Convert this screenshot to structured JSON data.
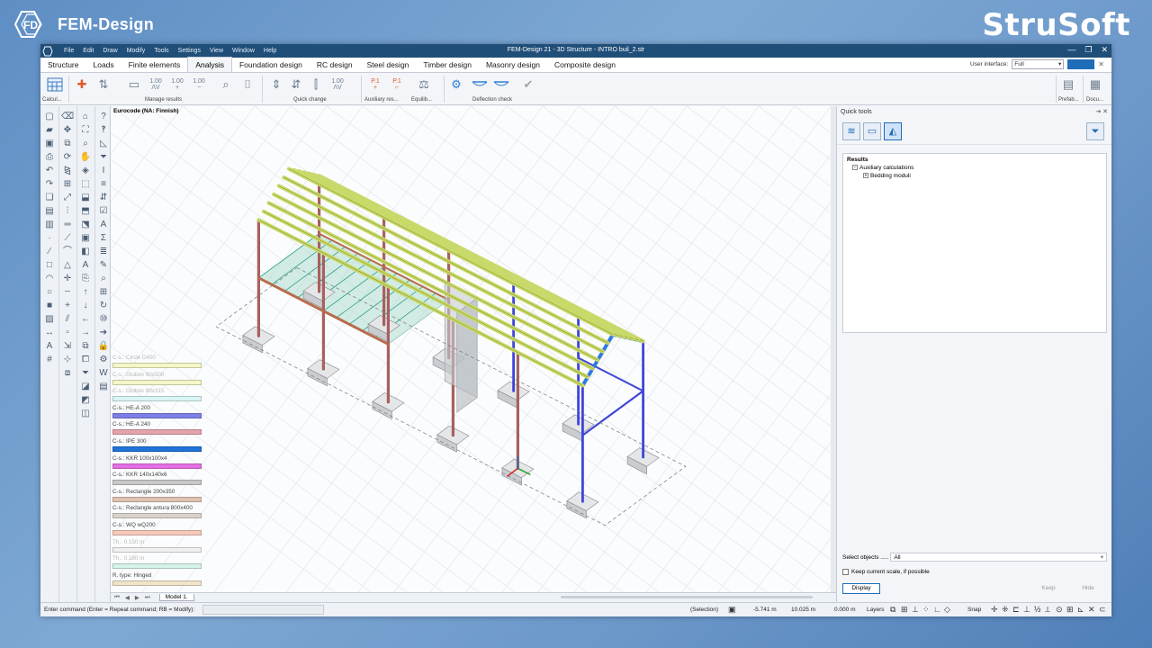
{
  "brand": {
    "left_name": "FEM-Design",
    "right_name": "StruSoft"
  },
  "window": {
    "title": "FEM-Design 21 - 3D Structure - INTRO buil_2.str",
    "menu": [
      "File",
      "Edit",
      "Draw",
      "Modify",
      "Tools",
      "Settings",
      "View",
      "Window",
      "Help"
    ],
    "controls": [
      "—",
      "❐",
      "✕"
    ]
  },
  "ribbon_tabs": [
    "Structure",
    "Loads",
    "Finite elements",
    "Analysis",
    "Foundation design",
    "RC design",
    "Steel design",
    "Timber design",
    "Masonry design",
    "Composite design"
  ],
  "active_tab": "Analysis",
  "user_interface": {
    "label": "User interface:",
    "value": "Full"
  },
  "ribbon_groups": {
    "calc": "Calcul...",
    "manage_results": "Manage results",
    "quick_change": "Quick change",
    "auxiliary": "Auxiliary res...",
    "equilib": "Equilib...",
    "deflection": "Deflection check",
    "prefab": "Prefab...",
    "docu": "Docu..."
  },
  "ribbon_icon_labels": {
    "p1_a": "P.1",
    "p1_b": "P.1",
    "n100": "1.00"
  },
  "viewport": {
    "code_label": "Eurocode (NA: Finnish)",
    "legend": [
      {
        "label": "C-s.: Circle D400",
        "color": "#f4f7c6",
        "faded": true
      },
      {
        "label": "C-s.: Globex 90x500",
        "color": "#f4f7c6",
        "faded": true
      },
      {
        "label": "C-s.: Globex 90x315",
        "color": "#d9f6f6",
        "faded": true
      },
      {
        "label": "C-s.: HE-A 200",
        "color": "#7c7fe6",
        "faded": false
      },
      {
        "label": "C-s.: HE-A 240",
        "color": "#e3a3ac",
        "faded": false
      },
      {
        "label": "C-s.: IPE 300",
        "color": "#1f73d9",
        "faded": false
      },
      {
        "label": "C-s.: KKR 100x100x4",
        "color": "#e46fe3",
        "faded": false
      },
      {
        "label": "C-s.: KKR 140x140x6",
        "color": "#c8c8c8",
        "faded": false
      },
      {
        "label": "C-s.: Rectangle 200x350",
        "color": "#e0c2b2",
        "faded": false
      },
      {
        "label": "C-s.: Rectangle antura 800x400",
        "color": "#d9d3cc",
        "faded": false
      },
      {
        "label": "C-s.: WQ wQ200",
        "color": "#f6c9b8",
        "faded": false
      },
      {
        "label": "Th.: 0.150 m",
        "color": "#f0f0f0",
        "faded": true
      },
      {
        "label": "Th.: 0.180 m",
        "color": "#d5f3e8",
        "faded": true
      },
      {
        "label": "R. type: Hinged",
        "color": "#efe3c8",
        "faded": false
      }
    ],
    "model_tab": "Model 1."
  },
  "quick_tools": {
    "title": "Quick tools",
    "tree_root": "Results",
    "tree_child": "Auxiliary calculations",
    "tree_grandchild": "Bedding moduli",
    "select_label": "Select objects .....",
    "select_value": "All",
    "keep_scale": "Keep current scale, if possible",
    "display_btn": "Display",
    "keep_btn": "Keep",
    "hide_btn": "Hide"
  },
  "status": {
    "command_prompt": "Enter command (Enter = Repeat command; RB = Modify):",
    "selection": "(Selection)",
    "x": "-5.741 m",
    "y": "10.025 m",
    "z": "0.000 m",
    "layers": "Layers",
    "snap": "Snap"
  },
  "colors": {
    "titlebar": "#1f4e79",
    "accent": "#1f6cb8",
    "beam_yellow": "#c9d96a",
    "column_red": "#a86060",
    "column_blue": "#3f45d8",
    "rafter_blue": "#2e7be0"
  }
}
